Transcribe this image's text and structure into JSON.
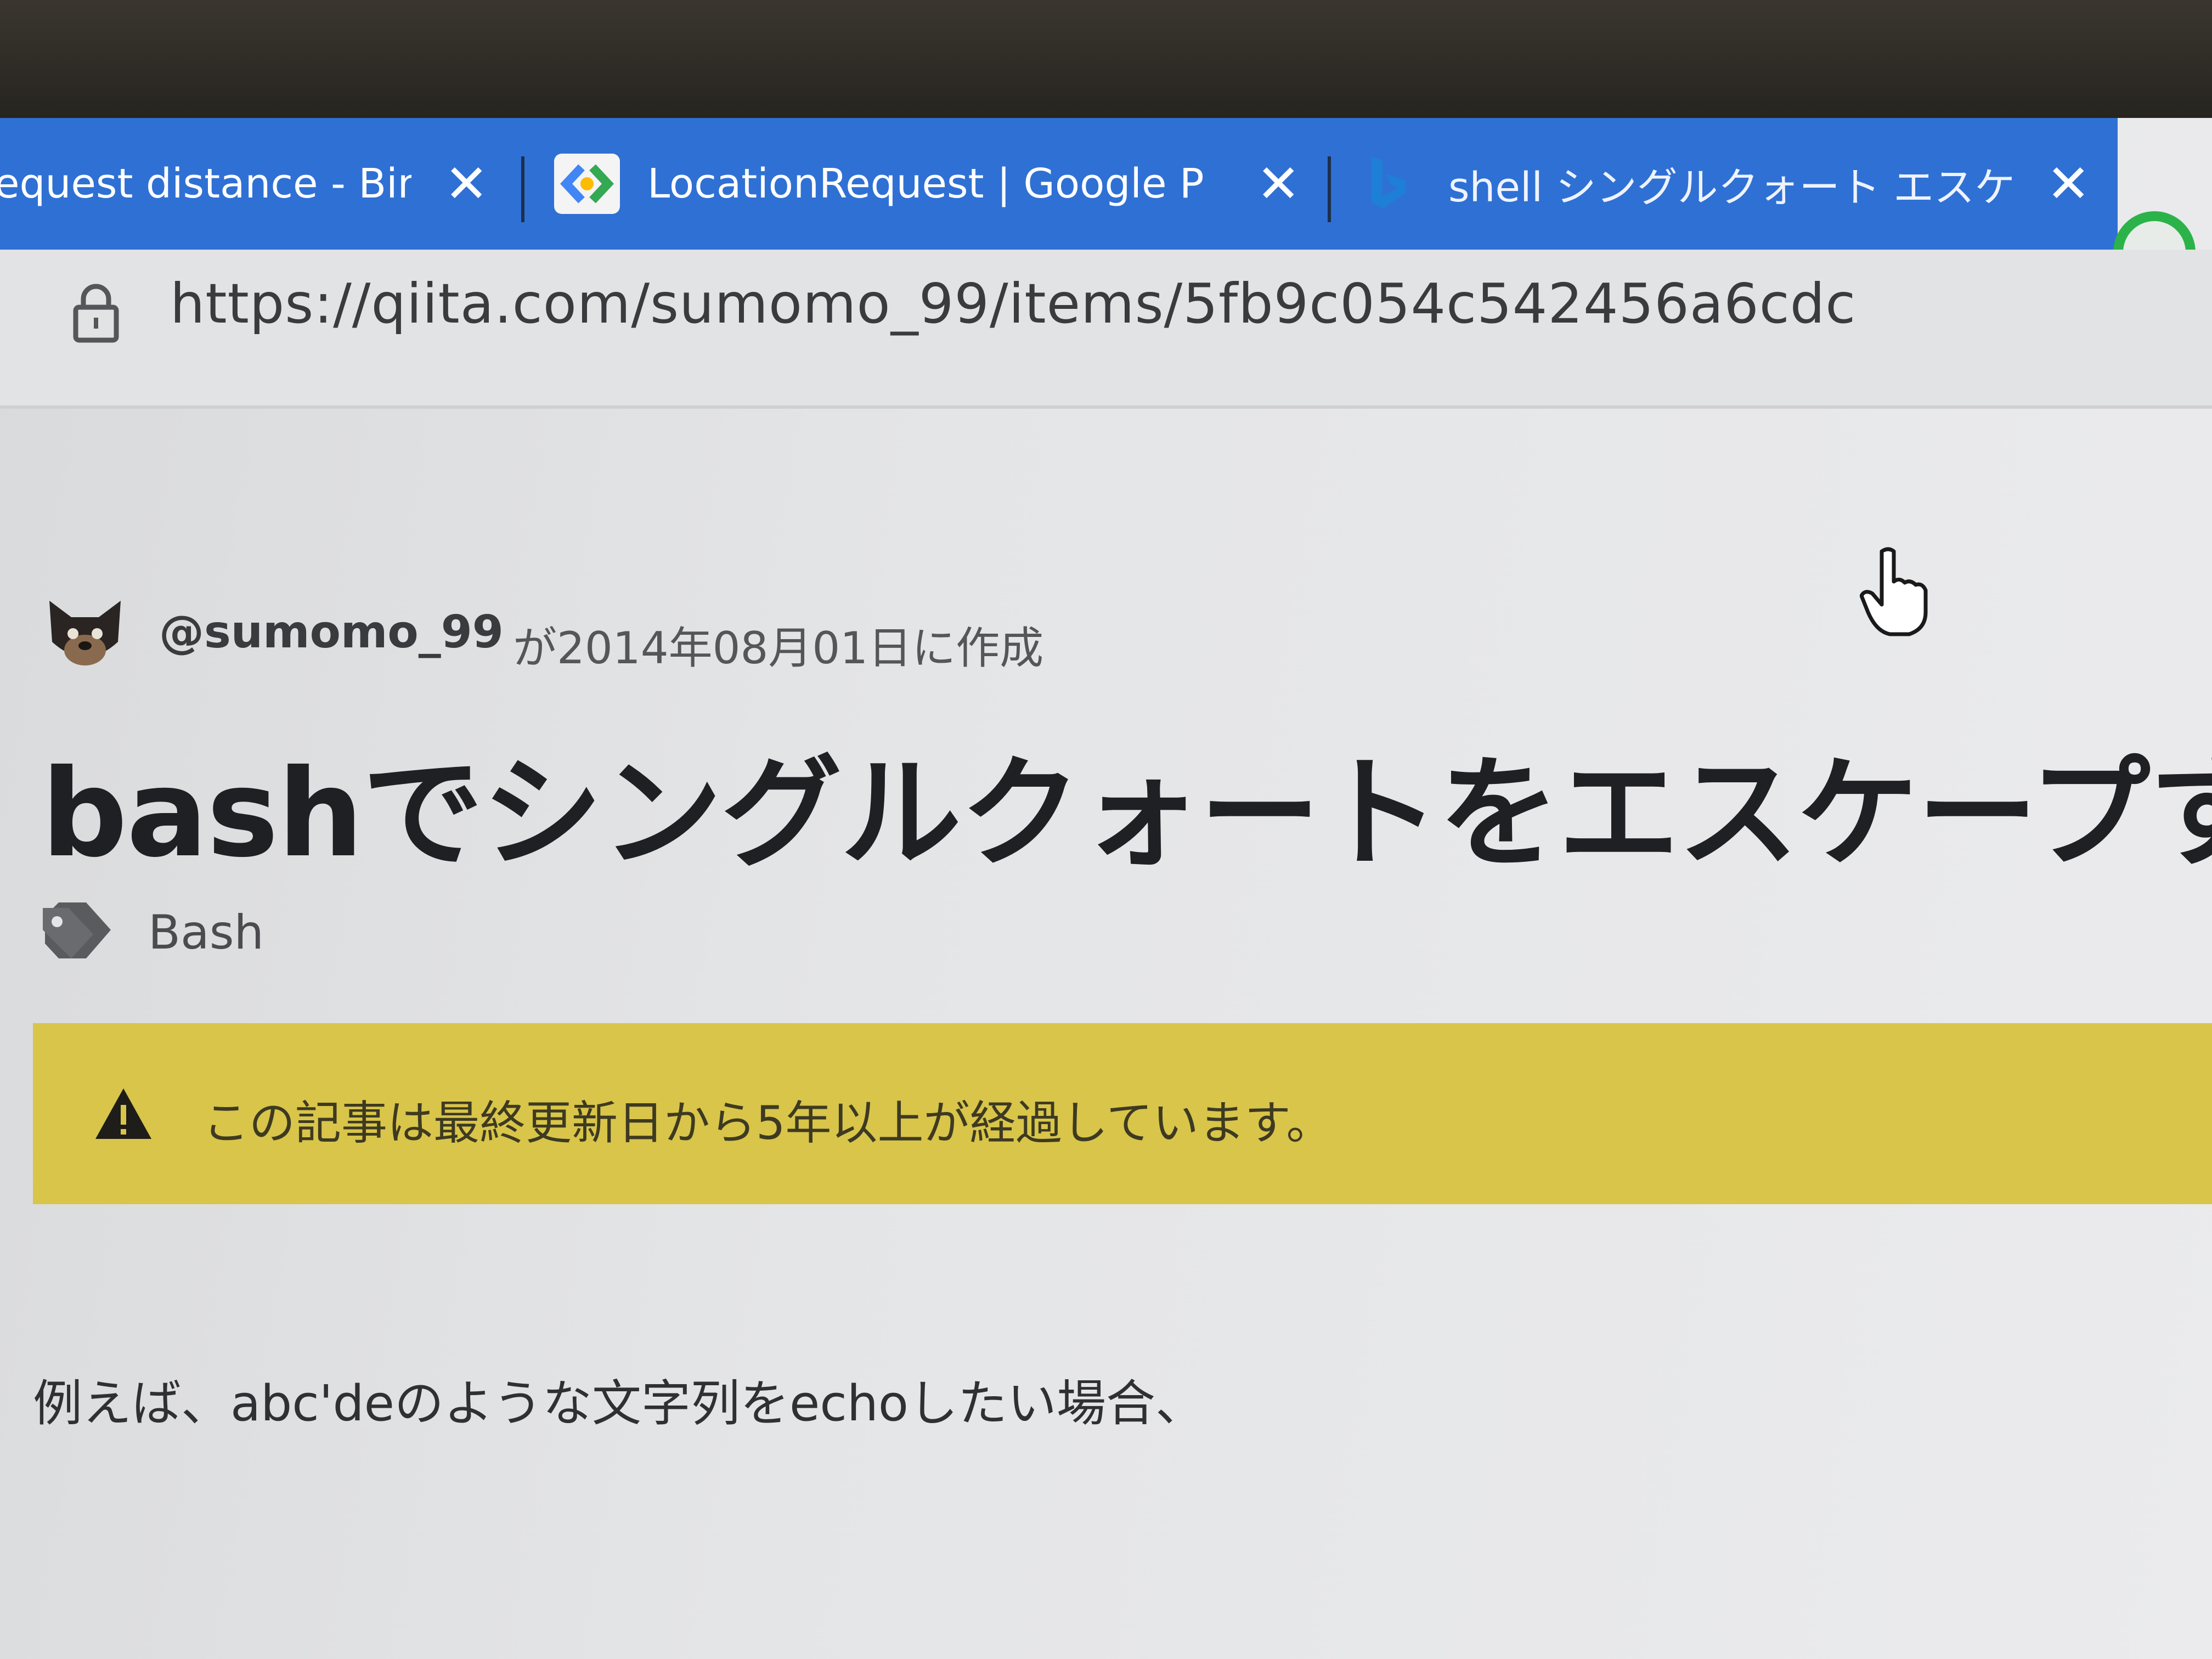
{
  "browser": {
    "tabs": [
      {
        "title": "equest distance - Bing",
        "close": "✕"
      },
      {
        "title": "LocationRequest | Google Play",
        "close": "✕"
      },
      {
        "title": "shell シングルクォート エスケープ - Bin",
        "close": "✕"
      }
    ],
    "url": "https://qiita.com/sumomo_99/items/5fb9c054c542456a6cdc"
  },
  "article": {
    "author": "@sumomo_99",
    "created": "が2014年08月01日に作成",
    "title": "bashでシングルクォートをエスケープする方",
    "tag": "Bash",
    "notice": "この記事は最終更新日から5年以上が経過しています。",
    "body_first_line": "例えば、abc'deのような文字列をechoしたい場合、"
  },
  "colors": {
    "tab_strip": "#2f70d4",
    "notice_banner": "#d8c54a",
    "profile_ring": "#2bb34a"
  }
}
